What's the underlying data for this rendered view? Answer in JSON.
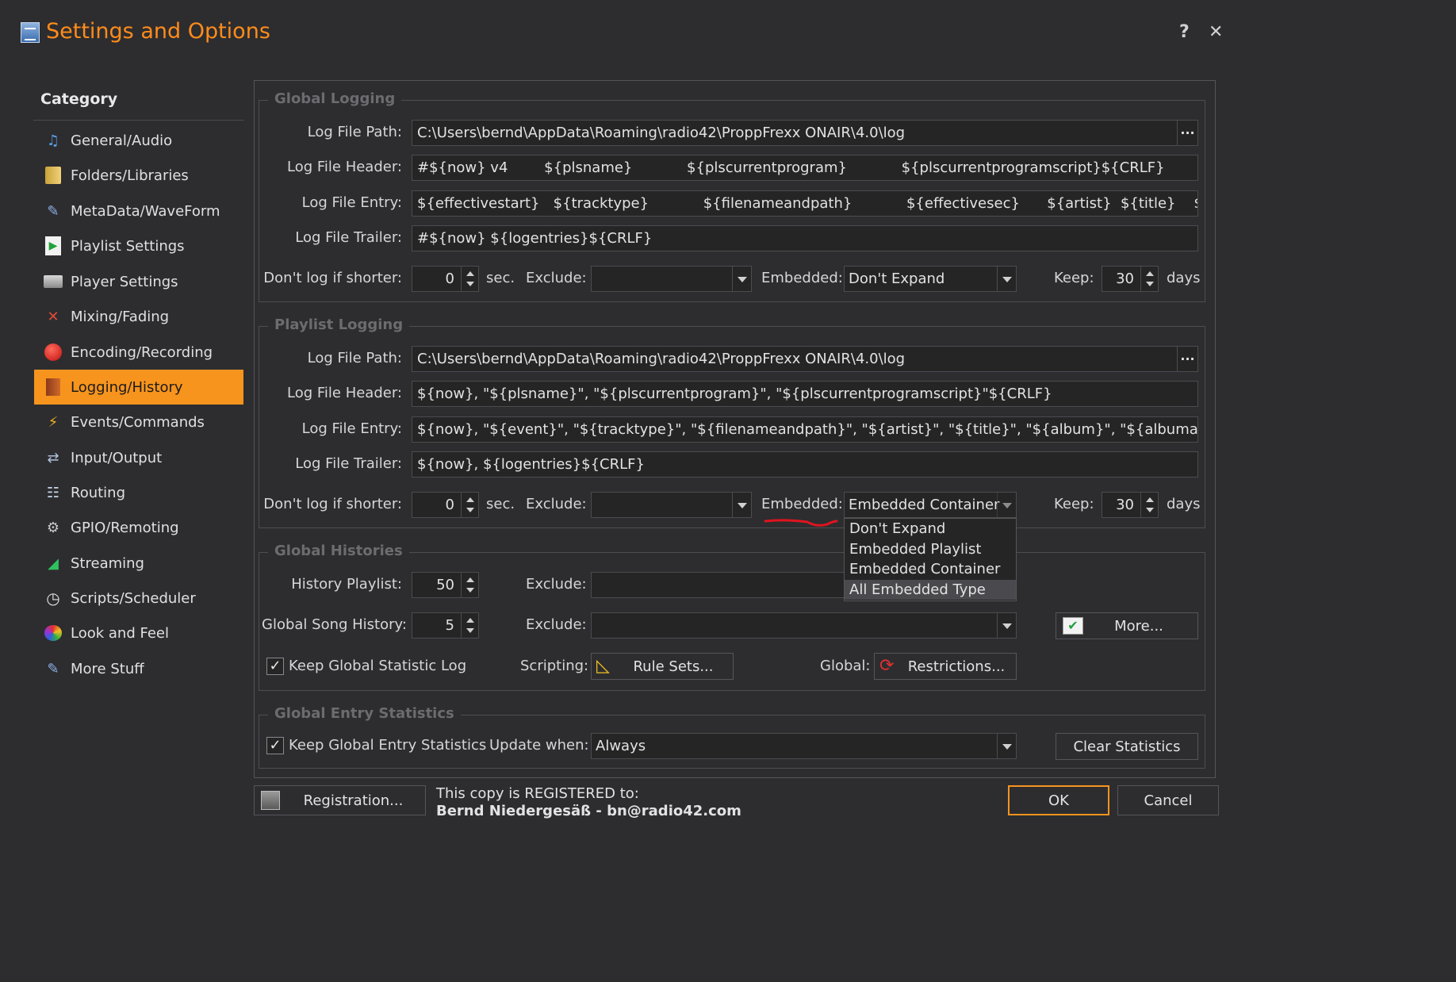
{
  "window": {
    "title": "Settings and Options",
    "help_label": "?",
    "close_label": "✕"
  },
  "sidebar": {
    "header": "Category",
    "items": [
      {
        "label": "General/Audio",
        "icon": "music-note-icon"
      },
      {
        "label": "Folders/Libraries",
        "icon": "folder-icon"
      },
      {
        "label": "MetaData/WaveForm",
        "icon": "metadata-icon"
      },
      {
        "label": "Playlist Settings",
        "icon": "play-icon"
      },
      {
        "label": "Player Settings",
        "icon": "player-icon"
      },
      {
        "label": "Mixing/Fading",
        "icon": "mixing-icon"
      },
      {
        "label": "Encoding/Recording",
        "icon": "record-icon"
      },
      {
        "label": "Logging/History",
        "icon": "book-icon",
        "selected": true
      },
      {
        "label": "Events/Commands",
        "icon": "lightning-icon"
      },
      {
        "label": "Input/Output",
        "icon": "input-output-icon"
      },
      {
        "label": "Routing",
        "icon": "routing-icon"
      },
      {
        "label": "GPIO/Remoting",
        "icon": "gpio-icon"
      },
      {
        "label": "Streaming",
        "icon": "streaming-icon"
      },
      {
        "label": "Scripts/Scheduler",
        "icon": "clock-icon"
      },
      {
        "label": "Look and Feel",
        "icon": "palette-icon"
      },
      {
        "label": "More Stuff",
        "icon": "more-stuff-icon"
      }
    ]
  },
  "global_logging": {
    "title": "Global Logging",
    "path_label": "Log File Path:",
    "path_value": "C:\\Users\\bernd\\AppData\\Roaming\\radio42\\ProppFrexx ONAIR\\4.0\\log",
    "browse_label": "···",
    "header_label": "Log File Header:",
    "header_value": "#${now} v4        ${plsname}            ${plscurrentprogram}            ${plscurrentprogramscript}${CRLF}",
    "entry_label": "Log File Entry:",
    "entry_value": "${effectivestart}   ${tracktype}            ${filenameandpath}            ${effectivesec}      ${artist}  ${title}    ${album}",
    "trailer_label": "Log File Trailer:",
    "trailer_value": "#${now} ${logentries}${CRLF}",
    "shorter_label": "Don't log if shorter:",
    "shorter_value": "0",
    "sec_label": "sec.",
    "exclude_label": "Exclude:",
    "exclude_value": "",
    "embedded_label": "Embedded:",
    "embedded_value": "Don't Expand",
    "keep_label": "Keep:",
    "keep_value": "30",
    "days_label": "days"
  },
  "playlist_logging": {
    "title": "Playlist Logging",
    "path_label": "Log File Path:",
    "path_value": "C:\\Users\\bernd\\AppData\\Roaming\\radio42\\ProppFrexx ONAIR\\4.0\\log",
    "browse_label": "···",
    "header_label": "Log File Header:",
    "header_value": "${now}, \"${plsname}\", \"${plscurrentprogram}\", \"${plscurrentprogramscript}\"${CRLF}",
    "entry_label": "Log File Entry:",
    "entry_value": "${now}, \"${event}\", \"${tracktype}\", \"${filenameandpath}\", \"${artist}\", \"${title}\", \"${album}\", \"${albumartist}\", \"${year",
    "trailer_label": "Log File Trailer:",
    "trailer_value": "${now}, ${logentries}${CRLF}",
    "shorter_label": "Don't log if shorter:",
    "shorter_value": "0",
    "sec_label": "sec.",
    "exclude_label": "Exclude:",
    "exclude_value": "",
    "embedded_label": "Embedded:",
    "embedded_value": "Embedded Container",
    "embedded_options": [
      "Don't Expand",
      "Embedded Playlist",
      "Embedded Container",
      "All Embedded Type"
    ],
    "embedded_highlighted": "All Embedded Type",
    "keep_label": "Keep:",
    "keep_value": "30",
    "days_label": "days"
  },
  "global_histories": {
    "title": "Global Histories",
    "history_playlist_label": "History Playlist:",
    "history_playlist_value": "50",
    "exclude1_label": "Exclude:",
    "song_history_label": "Global Song History:",
    "song_history_value": "5",
    "exclude2_label": "Exclude:",
    "more_label": "More...",
    "keep_stat_log_label": "Keep Global Statistic Log",
    "keep_stat_log_checked": true,
    "scripting_label": "Scripting:",
    "rule_sets_label": "Rule Sets...",
    "global_label": "Global:",
    "restrictions_label": "Restrictions..."
  },
  "global_entry_statistics": {
    "title": "Global Entry Statistics",
    "keep_entry_stats_label": "Keep Global Entry Statistics",
    "keep_entry_stats_checked": true,
    "update_when_label": "Update when:",
    "update_when_value": "Always",
    "clear_label": "Clear Statistics"
  },
  "footer": {
    "registration_label": "Registration...",
    "reg_line1": "This copy is REGISTERED to:",
    "reg_line2": "Bernd Niedergesäß - bn@radio42.com",
    "ok_label": "OK",
    "cancel_label": "Cancel"
  },
  "colors": {
    "accent": "#f7941d",
    "title": "#ff8c1a",
    "background": "#2d2d30",
    "annotation": "#e0141e"
  }
}
